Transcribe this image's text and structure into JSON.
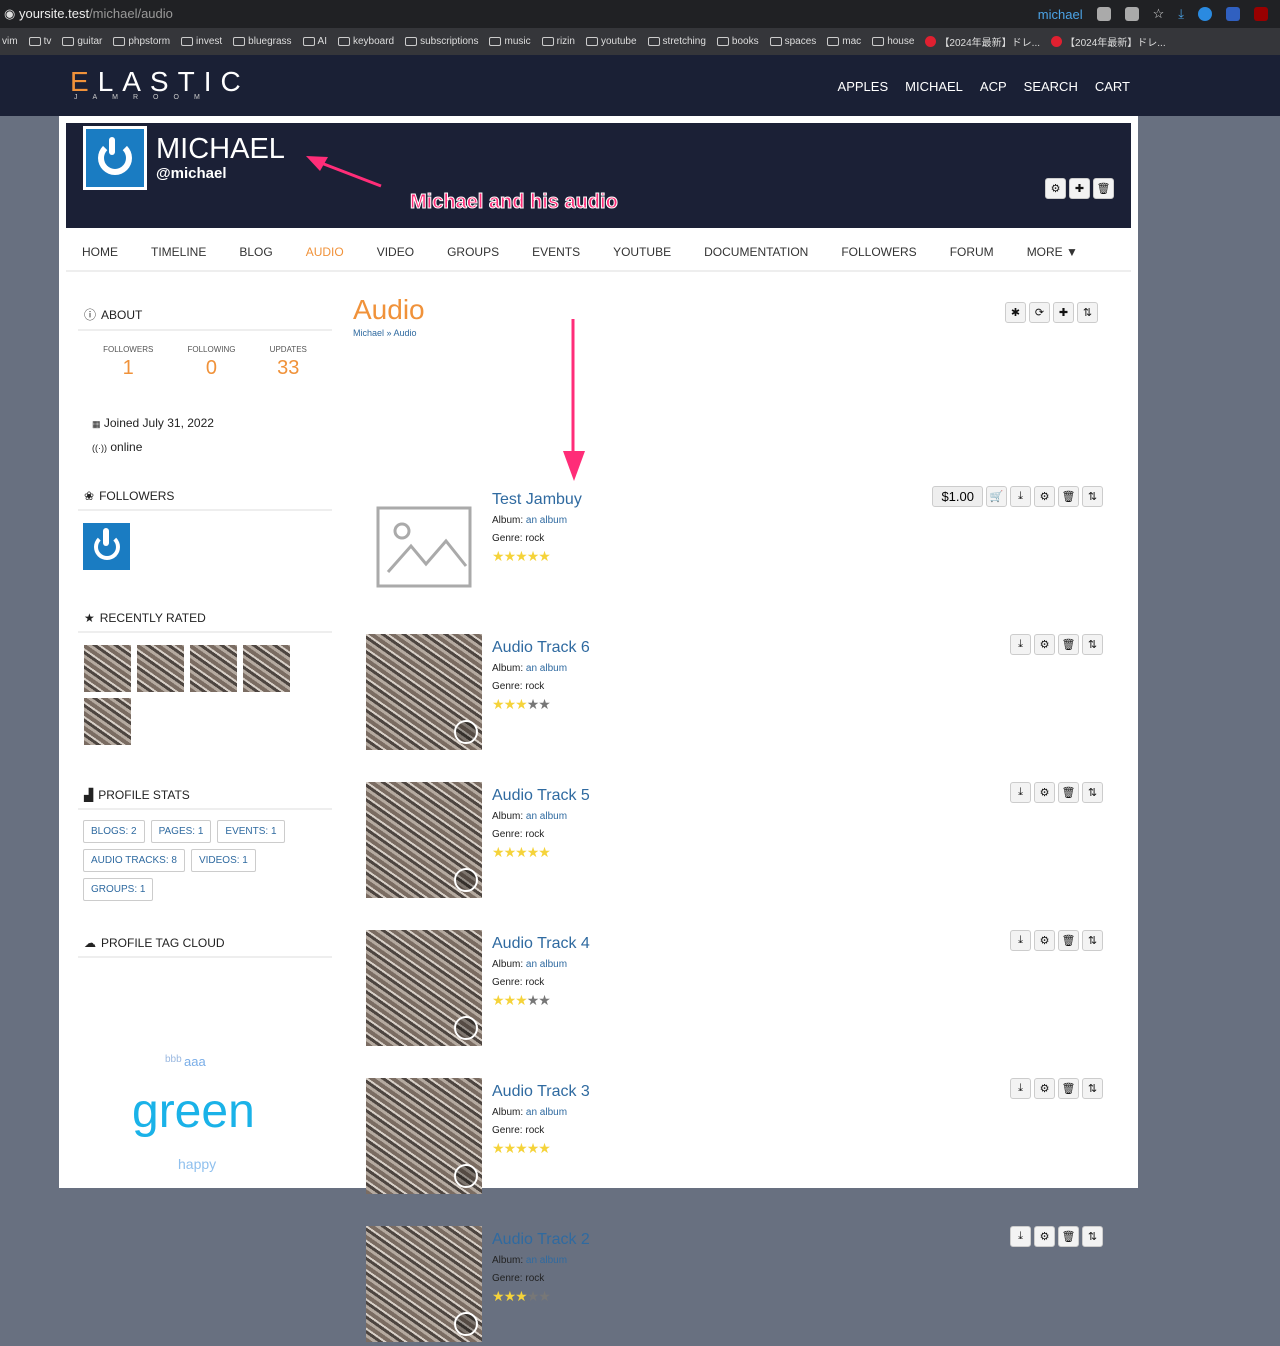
{
  "browser": {
    "url_host": "yoursite.test",
    "url_path": "/michael/audio",
    "profile": "michael",
    "bookmarks": [
      "vim",
      "tv",
      "guitar",
      "phpstorm",
      "invest",
      "bluegrass",
      "AI",
      "keyboard",
      "subscriptions",
      "music",
      "rizin",
      "youtube",
      "stretching",
      "books",
      "spaces",
      "mac",
      "house",
      "【2024年最新】ドレ...",
      "【2024年最新】ドレ..."
    ]
  },
  "site": {
    "logo_top": "LASTIC",
    "logo_first": "E",
    "logo_sub": "JAMROOM",
    "nav": [
      "APPLES",
      "MICHAEL",
      "ACP",
      "SEARCH",
      "CART"
    ]
  },
  "profile": {
    "name": "MICHAEL",
    "handle": "@michael",
    "annotation": "Michael and his audio"
  },
  "tabs": [
    "HOME",
    "TIMELINE",
    "BLOG",
    "AUDIO",
    "VIDEO",
    "GROUPS",
    "EVENTS",
    "YOUTUBE",
    "DOCUMENTATION",
    "FOLLOWERS",
    "FORUM",
    "MORE ▼"
  ],
  "sidebar": {
    "about": "ABOUT",
    "followers_label": "FOLLOWERS",
    "following_label": "FOLLOWING",
    "updates_label": "UPDATES",
    "followers": "1",
    "following": "0",
    "updates": "33",
    "joined": "Joined July 31, 2022",
    "status": "online",
    "followers_head": "FOLLOWERS",
    "recent": "RECENTLY RATED",
    "stats_head": "PROFILE STATS",
    "stats": [
      "BLOGS: 2",
      "PAGES: 1",
      "EVENTS: 1",
      "AUDIO TRACKS: 8",
      "VIDEOS: 1",
      "GROUPS: 1"
    ],
    "tag_head": "PROFILE TAG CLOUD",
    "tags": {
      "t1": "bbb",
      "t2": "aaa",
      "t3": "green",
      "t4": "happy"
    }
  },
  "main": {
    "title": "Audio",
    "crumb1": "Michael",
    "crumb2": "Audio",
    "album_label": "Album:",
    "genre_label": "Genre: ",
    "tracks": [
      {
        "title": "Test Jambuy",
        "album": "an album",
        "genre": "rock",
        "rating": 5,
        "price": "$1.00",
        "image": "placeholder"
      },
      {
        "title": "Audio Track 6",
        "album": "an album",
        "genre": "rock",
        "rating": 3
      },
      {
        "title": "Audio Track 5",
        "album": "an album",
        "genre": "rock",
        "rating": 5
      },
      {
        "title": "Audio Track 4",
        "album": "an album",
        "genre": "rock",
        "rating": 3
      },
      {
        "title": "Audio Track 3",
        "album": "an album",
        "genre": "rock",
        "rating": 5
      },
      {
        "title": "Audio Track 2",
        "album": "an album",
        "genre": "rock",
        "rating": 3
      }
    ]
  },
  "colors": {
    "accent": "#f0923a",
    "link": "#2f6aa0",
    "header": "#1a2035"
  }
}
